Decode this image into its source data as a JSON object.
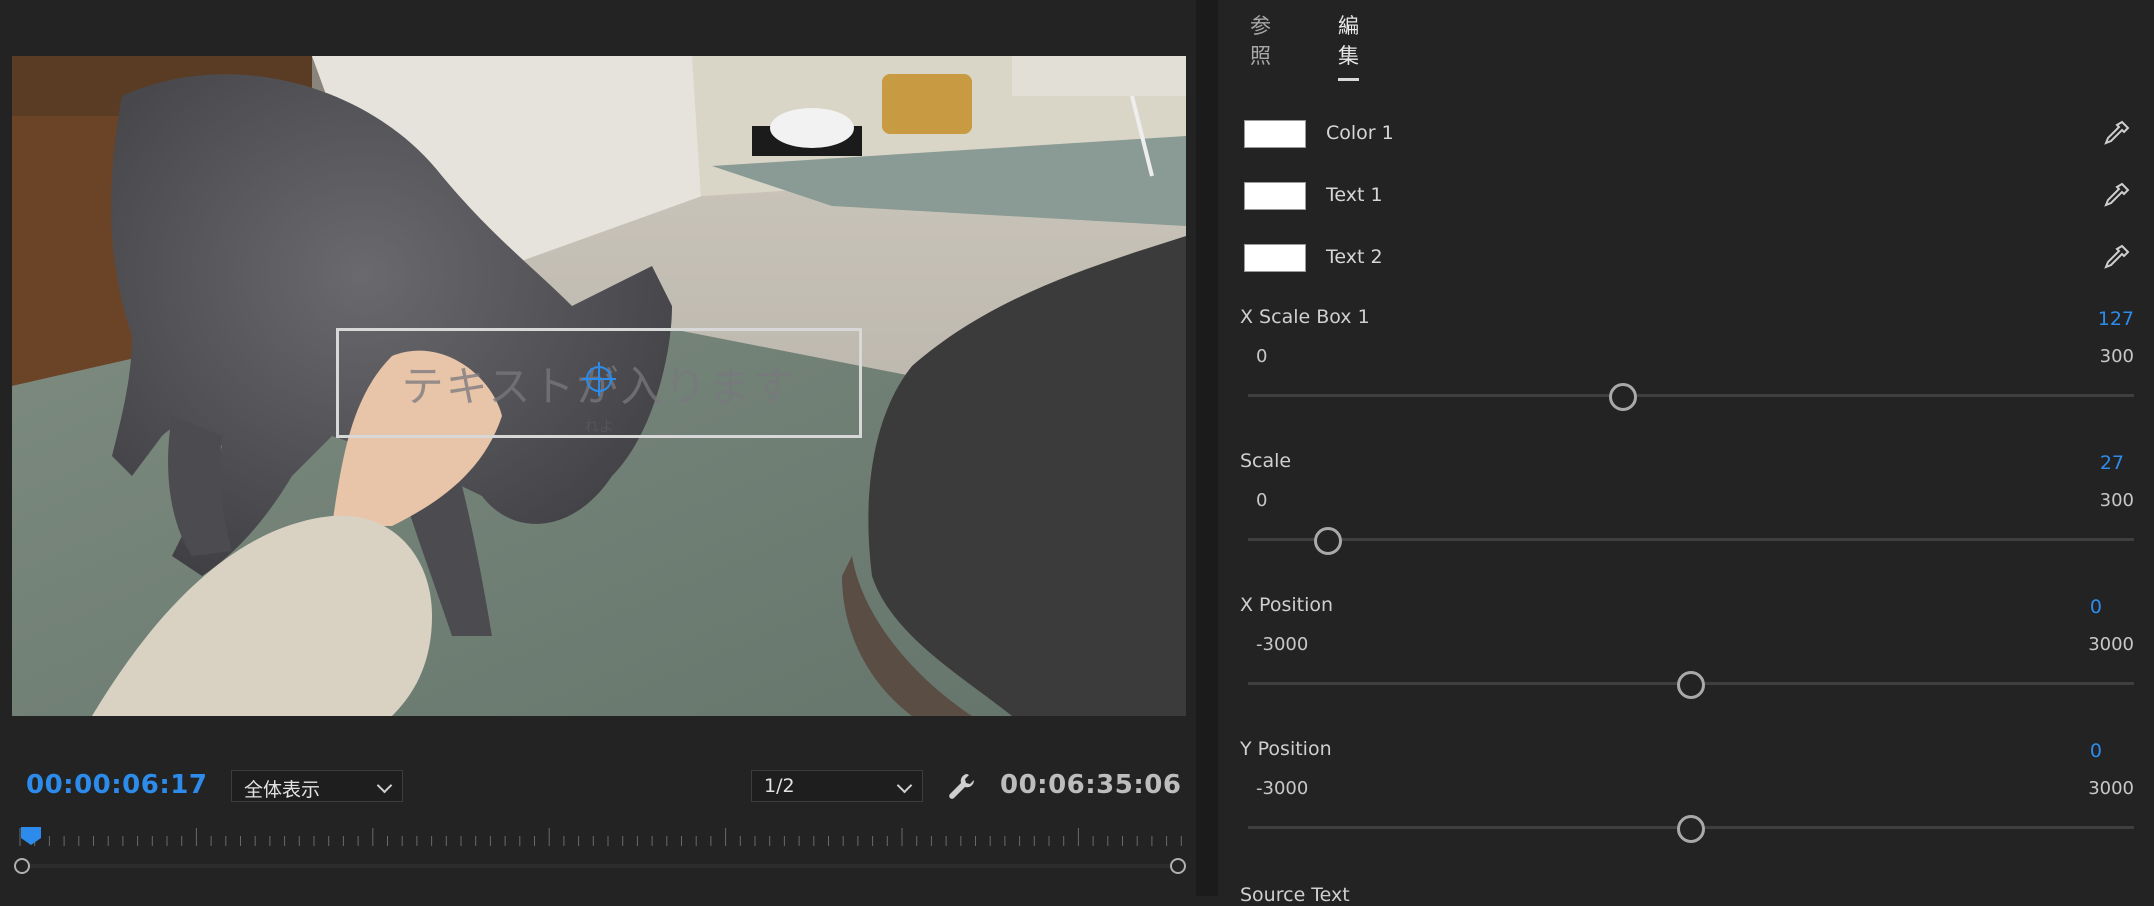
{
  "monitor": {
    "title_overlay": {
      "main_text": "テキストが入ります",
      "sub_text": "れよ"
    },
    "current_timecode": "00:00:06:17",
    "zoom_dropdown": {
      "selected": "全体表示"
    },
    "resolution_dropdown": {
      "selected": "1/2"
    },
    "duration_timecode": "00:06:35:06"
  },
  "panel": {
    "tabs": [
      {
        "label": "参照",
        "active": false
      },
      {
        "label": "編集",
        "active": true
      }
    ],
    "colors": [
      {
        "label": "Color 1",
        "value": "#ffffff"
      },
      {
        "label": "Text 1",
        "value": "#ffffff"
      },
      {
        "label": "Text 2",
        "value": "#ffffff"
      }
    ],
    "sliders": [
      {
        "name": "X Scale Box 1",
        "value": "127",
        "min": "0",
        "max": "300",
        "fraction": 0.4233
      },
      {
        "name": "Scale",
        "value": "27",
        "min": "0",
        "max": "300",
        "fraction": 0.09
      },
      {
        "name": "X Position",
        "value": "0",
        "min": "-3000",
        "max": "3000",
        "fraction": 0.5
      },
      {
        "name": "Y Position",
        "value": "0",
        "min": "-3000",
        "max": "3000",
        "fraction": 0.5
      }
    ],
    "next_label": "Source Text"
  },
  "accent_color": "#2d8ceb"
}
